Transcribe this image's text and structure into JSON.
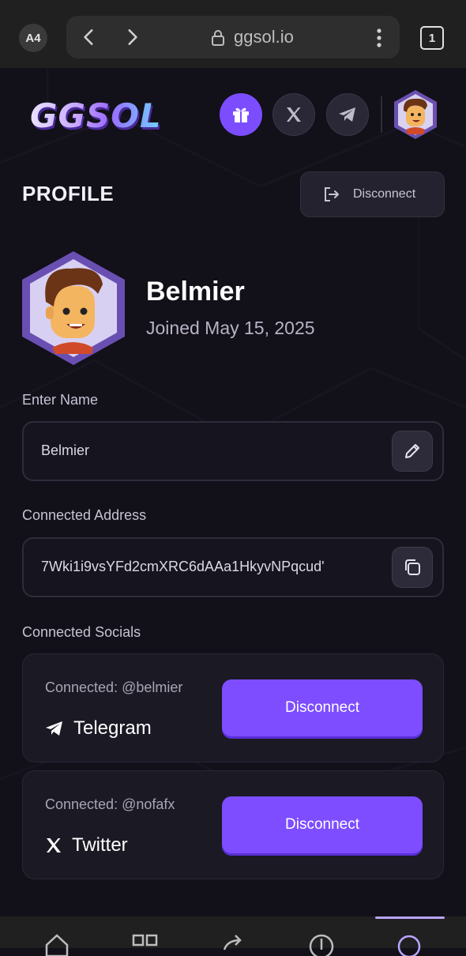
{
  "browser": {
    "tab_badge": "A4",
    "url": "ggsol.io",
    "tabs_count": "1"
  },
  "header": {
    "logo": "GGSOL"
  },
  "profile": {
    "title": "PROFILE",
    "disconnect_label": "Disconnect",
    "username": "Belmier",
    "joined": "Joined May 15, 2025"
  },
  "name_field": {
    "label": "Enter Name",
    "value": "Belmier"
  },
  "address_field": {
    "label": "Connected Address",
    "value": "7Wki1i9vsYFd2cmXRC6dAAa1HkyvNPqcud'"
  },
  "socials": {
    "label": "Connected Socials",
    "items": [
      {
        "status": "Connected: @belmier",
        "name": "Telegram",
        "button": "Disconnect",
        "icon": "telegram-icon"
      },
      {
        "status": "Connected: @nofafx",
        "name": "Twitter",
        "button": "Disconnect",
        "icon": "x-icon"
      }
    ]
  },
  "colors": {
    "accent": "#7b4dff",
    "background": "#121019"
  }
}
